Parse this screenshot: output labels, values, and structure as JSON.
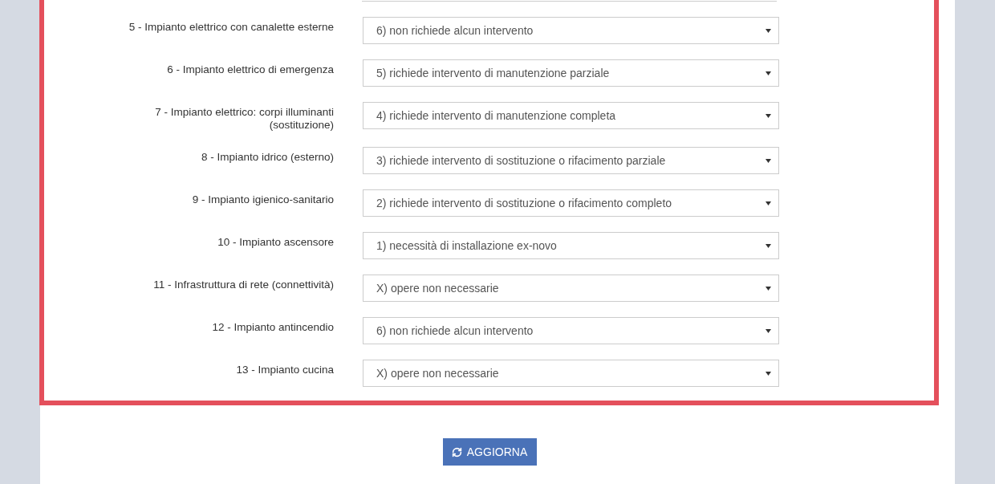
{
  "rows": [
    {
      "label": "5 - Impianto elettrico con canalette esterne",
      "value": "6) non richiede alcun intervento"
    },
    {
      "label": "6 - Impianto elettrico di emergenza",
      "value": "5) richiede intervento di manutenzione parziale"
    },
    {
      "label": "7 - Impianto elettrico: corpi illuminanti (sostituzione)",
      "value": "4) richiede intervento di manutenzione completa"
    },
    {
      "label": "8 - Impianto idrico (esterno)",
      "value": "3) richiede intervento di sostituzione o rifacimento parziale"
    },
    {
      "label": "9 - Impianto igienico-sanitario",
      "value": "2) richiede intervento di sostituzione o rifacimento completo"
    },
    {
      "label": "10 - Impianto ascensore",
      "value": "1) necessità di installazione ex-novo"
    },
    {
      "label": "11 - Infrastruttura di rete (connettività)",
      "value": "X) opere non necessarie"
    },
    {
      "label": "12 - Impianto antincendio",
      "value": "6) non richiede alcun intervento"
    },
    {
      "label": "13 - Impianto cucina",
      "value": "X) opere non necessarie"
    }
  ],
  "button": {
    "label": "AGGIORNA"
  }
}
